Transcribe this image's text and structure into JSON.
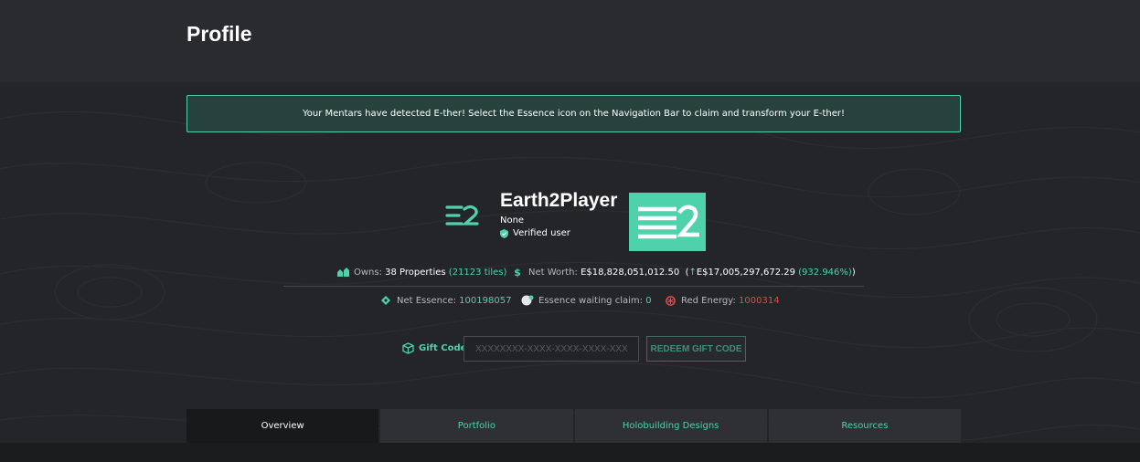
{
  "header": {
    "title": "Profile"
  },
  "alert": {
    "message": "Your Mentars have detected E-ther! Select the Essence icon on the Navigation Bar to claim and transform your E-ther!"
  },
  "profile": {
    "username": "Earth2Player",
    "subtitle": "None",
    "verified_label": "Verified user"
  },
  "stats": {
    "owns_label": "Owns:",
    "owns_properties": "38 Properties",
    "owns_tiles": "(21123 tiles)",
    "net_worth_label": "Net Worth:",
    "net_worth_value": "E$18,828,051,012.50",
    "change_open": "(",
    "change_arrow": "↑",
    "change_value": "E$17,005,297,672.29",
    "change_percent": "(932.946%)",
    "change_close": ")",
    "net_essence_label": "Net Essence:",
    "net_essence_value": "100198057",
    "essence_claim_label": "Essence waiting claim:",
    "essence_claim_value": "0",
    "red_energy_label": "Red Energy:",
    "red_energy_value": "1000314"
  },
  "gift": {
    "label": "Gift Code",
    "placeholder": "XXXXXXXX-XXXX-XXXX-XXXX-XXX",
    "button_label": "REDEEM GIFT CODE"
  },
  "tabs": [
    {
      "label": "Overview",
      "active": true
    },
    {
      "label": "Portfolio",
      "active": false
    },
    {
      "label": "Holobuilding Designs",
      "active": false
    },
    {
      "label": "Resources",
      "active": false
    }
  ],
  "colors": {
    "accent": "#4fd1ac",
    "danger": "#e24a4a",
    "background": "#242529"
  },
  "icons": [
    "properties-icon",
    "dollar-icon",
    "essence-icon",
    "essence-claim-icon",
    "red-energy-icon",
    "gift-icon",
    "verified-shield-icon",
    "earth2-logo-icon"
  ]
}
